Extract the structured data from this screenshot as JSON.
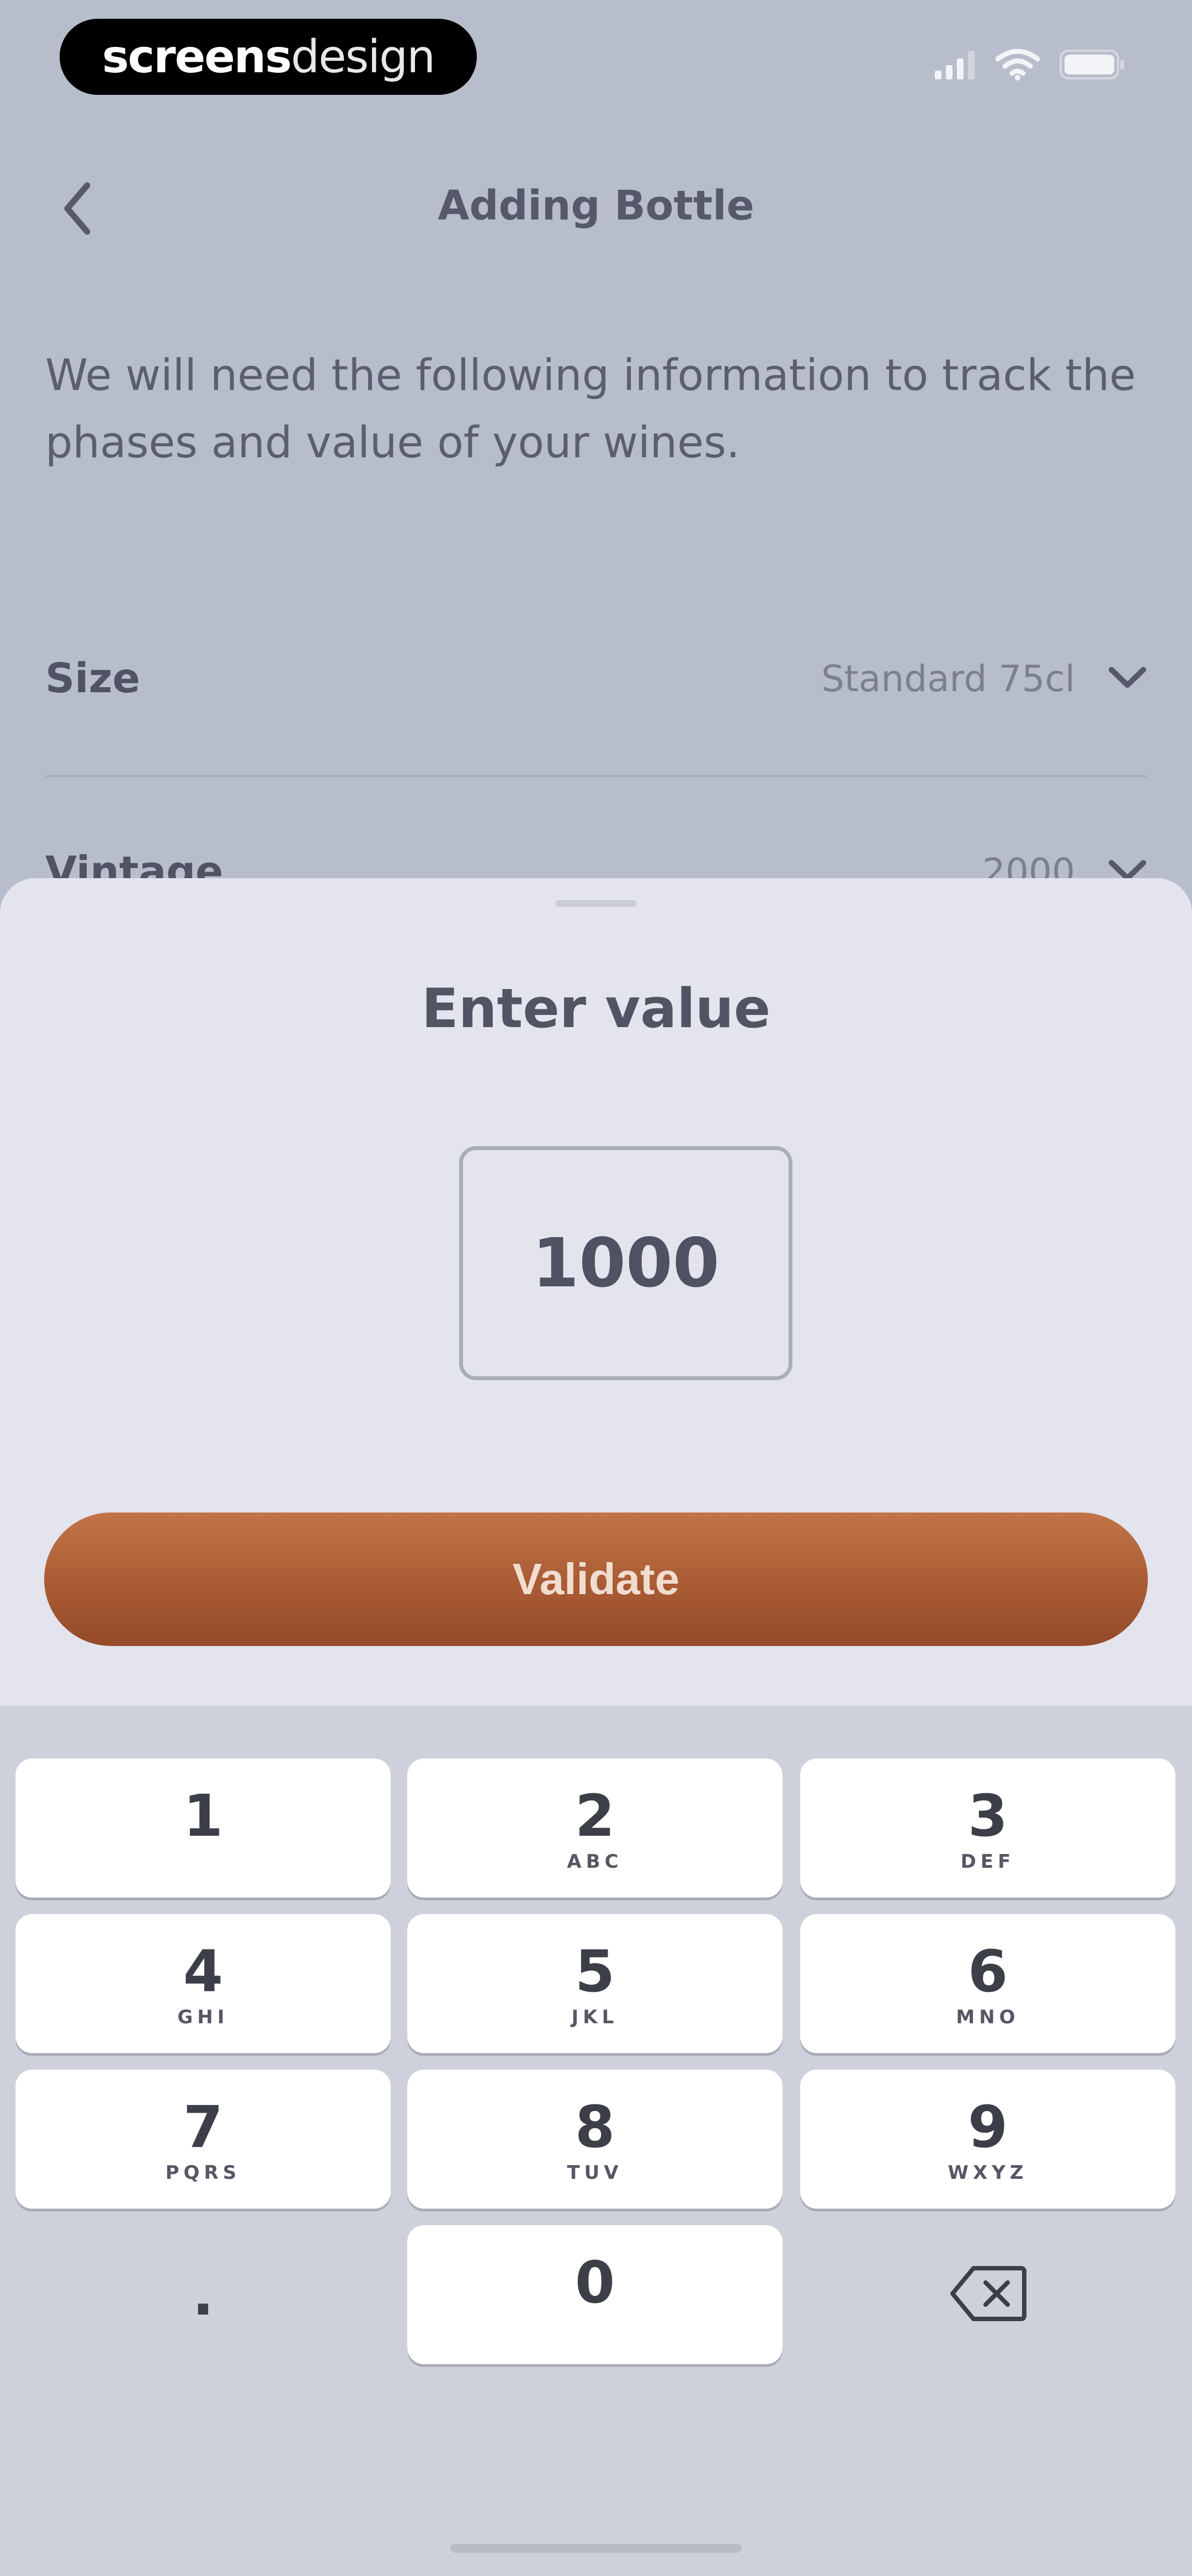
{
  "status_bar": {
    "brand_bold": "screens",
    "brand_light": "design",
    "icons": [
      "cellular-signal-icon",
      "wifi-icon",
      "battery-icon"
    ]
  },
  "header": {
    "back_icon": "chevron-left-icon",
    "title": "Adding Bottle"
  },
  "intro": {
    "text": "We will need the following information to track the phases and value of your wines."
  },
  "form": {
    "rows": [
      {
        "label": "Size",
        "value": "Standard 75cl",
        "icon": "chevron-down-icon"
      },
      {
        "label": "Vintage",
        "value": "2000",
        "icon": "chevron-down-icon"
      }
    ]
  },
  "sheet": {
    "title": "Enter value",
    "input_value": "1000",
    "validate_label": "Validate"
  },
  "keypad": {
    "keys": [
      {
        "digit": "1",
        "letters": ""
      },
      {
        "digit": "2",
        "letters": "ABC"
      },
      {
        "digit": "3",
        "letters": "DEF"
      },
      {
        "digit": "4",
        "letters": "GHI"
      },
      {
        "digit": "5",
        "letters": "JKL"
      },
      {
        "digit": "6",
        "letters": "MNO"
      },
      {
        "digit": "7",
        "letters": "PQRS"
      },
      {
        "digit": "8",
        "letters": "TUV"
      },
      {
        "digit": "9",
        "letters": "WXYZ"
      },
      {
        "digit": "0",
        "letters": ""
      }
    ],
    "decimal_label": ".",
    "delete_icon": "backspace-icon"
  },
  "colors": {
    "accent": "#a95b34",
    "sheet_bg": "#e3e4ed",
    "keypad_bg": "#ced0db",
    "dimmed_bg": "#b8bdcb"
  }
}
